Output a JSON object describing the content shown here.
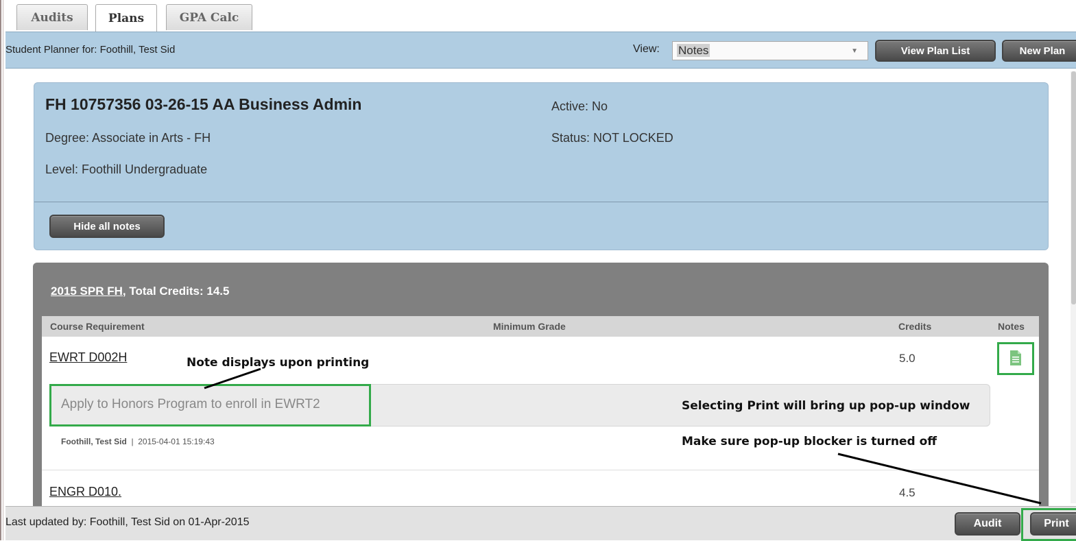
{
  "tabs": [
    {
      "label": "Audits",
      "active": false
    },
    {
      "label": "Plans",
      "active": true
    },
    {
      "label": "GPA Calc",
      "active": false
    }
  ],
  "header": {
    "title": "Student Planner for: Foothill, Test Sid",
    "view_label": "View:",
    "view_value": "Notes",
    "view_plan_list_label": "View Plan List",
    "new_plan_label": "New Plan"
  },
  "plan": {
    "title": "FH 10757356 03-26-15 AA Business Admin",
    "degree": "Degree: Associate in Arts - FH",
    "level": "Level: Foothill Undergraduate",
    "active": "Active: No",
    "status": "Status: NOT LOCKED",
    "hide_notes_label": "Hide all notes"
  },
  "term": {
    "term_link": "2015 SPR FH",
    "total_credits": ", Total Credits: 14.5",
    "columns": {
      "course": "Course Requirement",
      "min_grade": "Minimum Grade",
      "credits": "Credits",
      "notes": "Notes"
    },
    "courses": [
      {
        "code": "EWRT D002H",
        "credits": "5.0",
        "note_text": "Apply to Honors Program to enroll in EWRT2",
        "note_author": "Foothill, Test Sid",
        "note_meta": "  |  2015-04-01 15:19:43"
      },
      {
        "code": "ENGR D010.",
        "credits": "4.5"
      }
    ]
  },
  "annotations": {
    "note_display": "Note displays upon printing",
    "print_popup": "Selecting Print will bring up pop-up window",
    "popup_blocker": "Make sure pop-up blocker is turned off"
  },
  "footer": {
    "last_updated": "Last updated by: Foothill, Test Sid on 01-Apr-2015",
    "audit_label": "Audit",
    "print_label": "Print"
  },
  "colors": {
    "highlight": "#33aa4a",
    "header_blue": "#b0cde2"
  },
  "icons": [
    "note-document-icon",
    "dropdown-caret-icon"
  ]
}
